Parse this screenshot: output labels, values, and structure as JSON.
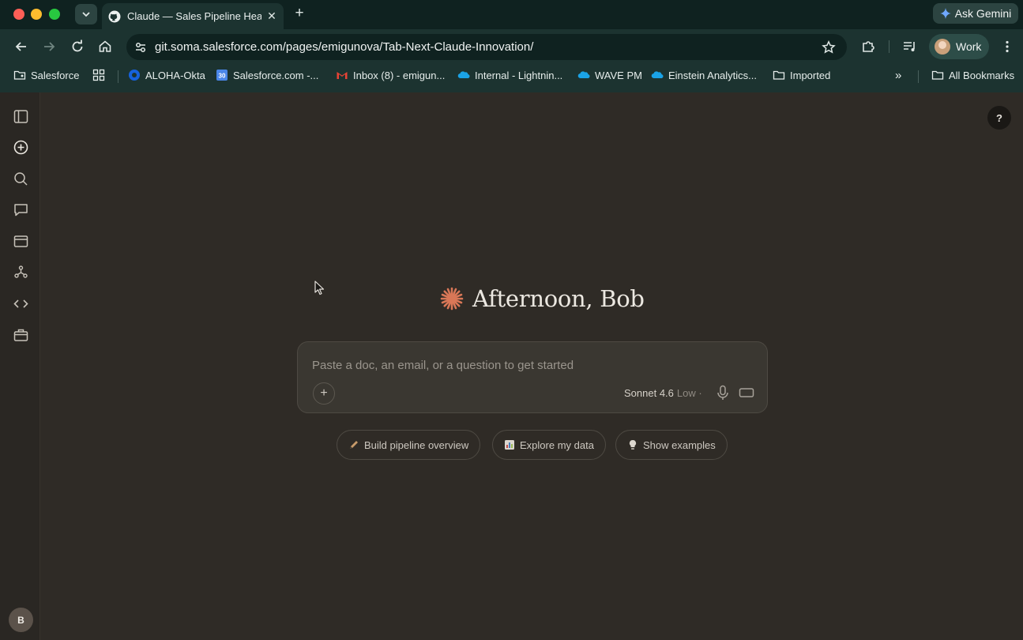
{
  "browser": {
    "tab": {
      "title": "Claude — Sales Pipeline Healt",
      "close": "✕"
    },
    "new_tab": "+",
    "ask_gemini": "Ask Gemini",
    "url": "git.soma.salesforce.com/pages/emigunova/Tab-Next-Claude-Innovation/",
    "profile": "Work",
    "bookmarks": [
      {
        "label": "Salesforce",
        "icon": "folder-person-icon"
      },
      {
        "label": "",
        "icon": "apps-grid-icon"
      },
      {
        "label": "ALOHA-Okta",
        "icon": "okta-icon"
      },
      {
        "label": "Salesforce.com -...",
        "icon": "calendar-30-icon"
      },
      {
        "label": "Inbox (8) - emigun...",
        "icon": "gmail-icon"
      },
      {
        "label": "Internal - Lightnin...",
        "icon": "salesforce-cloud-icon"
      },
      {
        "label": "WAVE PM",
        "icon": "salesforce-cloud-icon"
      },
      {
        "label": "Einstein Analytics...",
        "icon": "salesforce-cloud-icon"
      },
      {
        "label": "Imported",
        "icon": "folder-icon"
      }
    ],
    "bookmarks_overflow": "»",
    "all_bookmarks": "All Bookmarks",
    "calendar_badge": "30"
  },
  "app": {
    "greeting": "Afternoon, Bob",
    "composer": {
      "placeholder": "Paste a doc, an email, or a question to get started",
      "attach": "+",
      "model": "Sonnet 4.6",
      "effort": "Low ·"
    },
    "suggestions": [
      {
        "label": "Build pipeline overview",
        "icon": "pencil-icon"
      },
      {
        "label": "Explore my data",
        "icon": "bar-chart-icon"
      },
      {
        "label": "Show examples",
        "icon": "lightbulb-icon"
      }
    ],
    "help": "?",
    "user_initial": "B"
  },
  "colors": {
    "accent_spark": "#d97757",
    "app_background": "#2f2b26",
    "chrome_background": "#1c3330"
  }
}
